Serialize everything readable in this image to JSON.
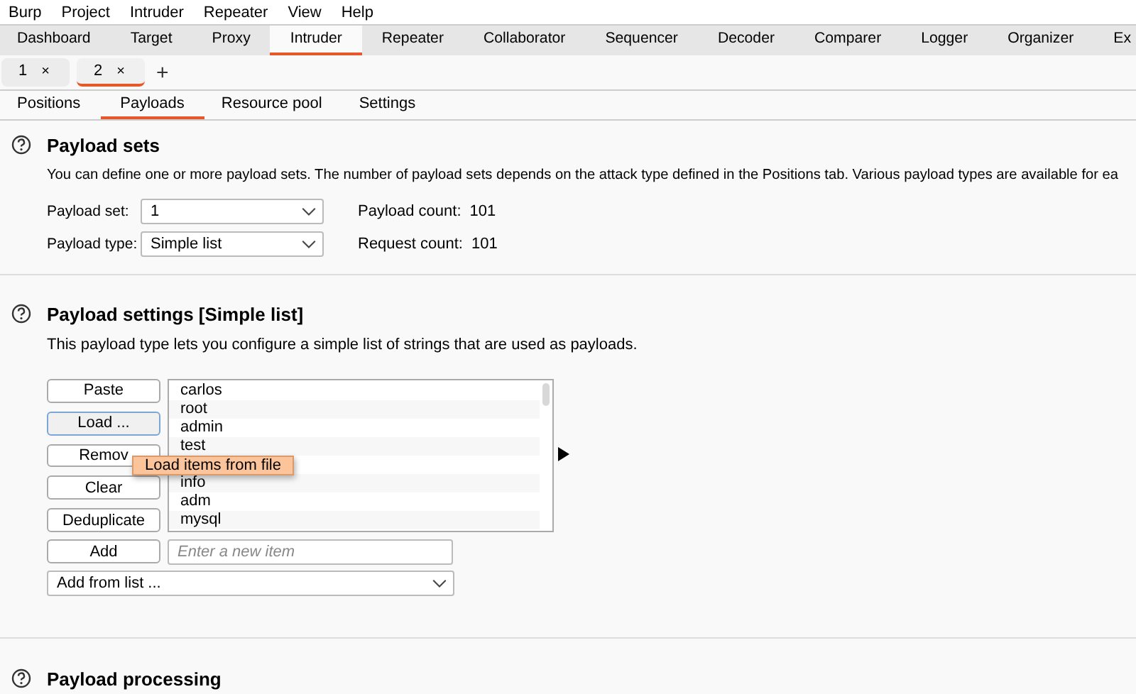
{
  "menu_bar": [
    "Burp",
    "Project",
    "Intruder",
    "Repeater",
    "View",
    "Help"
  ],
  "tool_tabs": [
    {
      "label": "Dashboard",
      "selected": false
    },
    {
      "label": "Target",
      "selected": false
    },
    {
      "label": "Proxy",
      "selected": false
    },
    {
      "label": "Intruder",
      "selected": true
    },
    {
      "label": "Repeater",
      "selected": false
    },
    {
      "label": "Collaborator",
      "selected": false
    },
    {
      "label": "Sequencer",
      "selected": false
    },
    {
      "label": "Decoder",
      "selected": false
    },
    {
      "label": "Comparer",
      "selected": false
    },
    {
      "label": "Logger",
      "selected": false
    },
    {
      "label": "Organizer",
      "selected": false
    },
    {
      "label": "Ex",
      "selected": false
    }
  ],
  "attack_tabs": [
    {
      "label": "1",
      "close": "×",
      "selected": false
    },
    {
      "label": "2",
      "close": "×",
      "selected": true
    }
  ],
  "new_tab": "+",
  "sub_tabs": [
    {
      "label": "Positions",
      "selected": false
    },
    {
      "label": "Payloads",
      "selected": true
    },
    {
      "label": "Resource pool",
      "selected": false
    },
    {
      "label": "Settings",
      "selected": false
    }
  ],
  "payload_sets": {
    "title": "Payload sets",
    "description": "You can define one or more payload sets. The number of payload sets depends on the attack type defined in the Positions tab. Various payload types are available for ea",
    "set_label": "Payload set:",
    "set_value": "1",
    "type_label": "Payload type:",
    "type_value": "Simple list",
    "payload_count_label": "Payload count:",
    "payload_count": "101",
    "request_count_label": "Request count:",
    "request_count": "101"
  },
  "payload_settings": {
    "title": "Payload settings [Simple list]",
    "description": "This payload type lets you configure a simple list of strings that are used as payloads.",
    "buttons": [
      "Paste",
      "Load ...",
      "Remov",
      "Clear",
      "Deduplicate"
    ],
    "items": [
      "carlos",
      "root",
      "admin",
      "test",
      "info",
      "adm",
      "mysql"
    ],
    "add_button": "Add",
    "new_item_placeholder": "Enter a new item",
    "add_from_list": "Add from list ...",
    "tooltip": "Load items from file"
  },
  "payload_processing": {
    "title": "Payload processing"
  }
}
